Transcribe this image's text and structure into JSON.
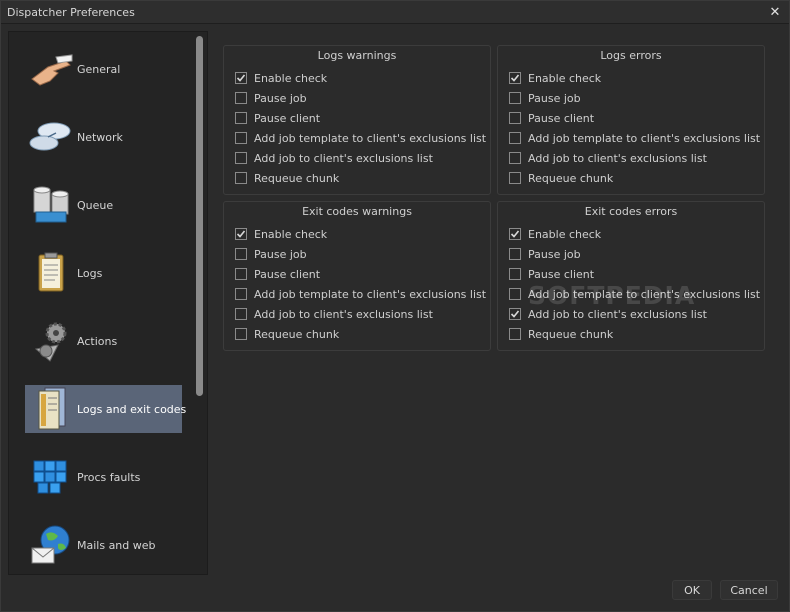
{
  "window": {
    "title": "Dispatcher Preferences",
    "close_glyph": "✕"
  },
  "sidebar": {
    "items": [
      {
        "label": "General",
        "icon": "pointing-hand-icon"
      },
      {
        "label": "Network",
        "icon": "network-clouds-icon"
      },
      {
        "label": "Queue",
        "icon": "database-icon"
      },
      {
        "label": "Logs",
        "icon": "clipboard-icon"
      },
      {
        "label": "Actions",
        "icon": "gears-icon"
      },
      {
        "label": "Logs and exit codes",
        "icon": "document-stack-icon",
        "selected": true
      },
      {
        "label": "Procs faults",
        "icon": "cubes-icon"
      },
      {
        "label": "Mails and web",
        "icon": "globe-mail-icon"
      }
    ]
  },
  "groups": [
    {
      "title": "Logs warnings",
      "options": [
        {
          "label": "Enable check",
          "checked": true
        },
        {
          "label": "Pause job",
          "checked": false
        },
        {
          "label": "Pause client",
          "checked": false
        },
        {
          "label": "Add job template to client's exclusions list",
          "checked": false
        },
        {
          "label": "Add job to client's exclusions list",
          "checked": false
        },
        {
          "label": "Requeue chunk",
          "checked": false
        }
      ]
    },
    {
      "title": "Logs errors",
      "options": [
        {
          "label": "Enable check",
          "checked": true
        },
        {
          "label": "Pause job",
          "checked": false
        },
        {
          "label": "Pause client",
          "checked": false
        },
        {
          "label": "Add job template to client's exclusions list",
          "checked": false
        },
        {
          "label": "Add job to client's exclusions list",
          "checked": false
        },
        {
          "label": "Requeue chunk",
          "checked": false
        }
      ]
    },
    {
      "title": "Exit codes warnings",
      "options": [
        {
          "label": "Enable check",
          "checked": true
        },
        {
          "label": "Pause job",
          "checked": false
        },
        {
          "label": "Pause client",
          "checked": false
        },
        {
          "label": "Add job template to client's exclusions list",
          "checked": false
        },
        {
          "label": "Add job to client's exclusions list",
          "checked": false
        },
        {
          "label": "Requeue chunk",
          "checked": false
        }
      ]
    },
    {
      "title": "Exit codes errors",
      "options": [
        {
          "label": "Enable check",
          "checked": true
        },
        {
          "label": "Pause job",
          "checked": false
        },
        {
          "label": "Pause client",
          "checked": false
        },
        {
          "label": "Add job template to client's exclusions list",
          "checked": false
        },
        {
          "label": "Add job to client's exclusions list",
          "checked": true
        },
        {
          "label": "Requeue chunk",
          "checked": false
        }
      ]
    }
  ],
  "watermark": "SOFTPEDIA",
  "footer": {
    "ok_label": "OK",
    "cancel_label": "Cancel"
  },
  "colors": {
    "selected": "#5a6578",
    "background": "#2b2b2b",
    "panel": "#242424"
  }
}
